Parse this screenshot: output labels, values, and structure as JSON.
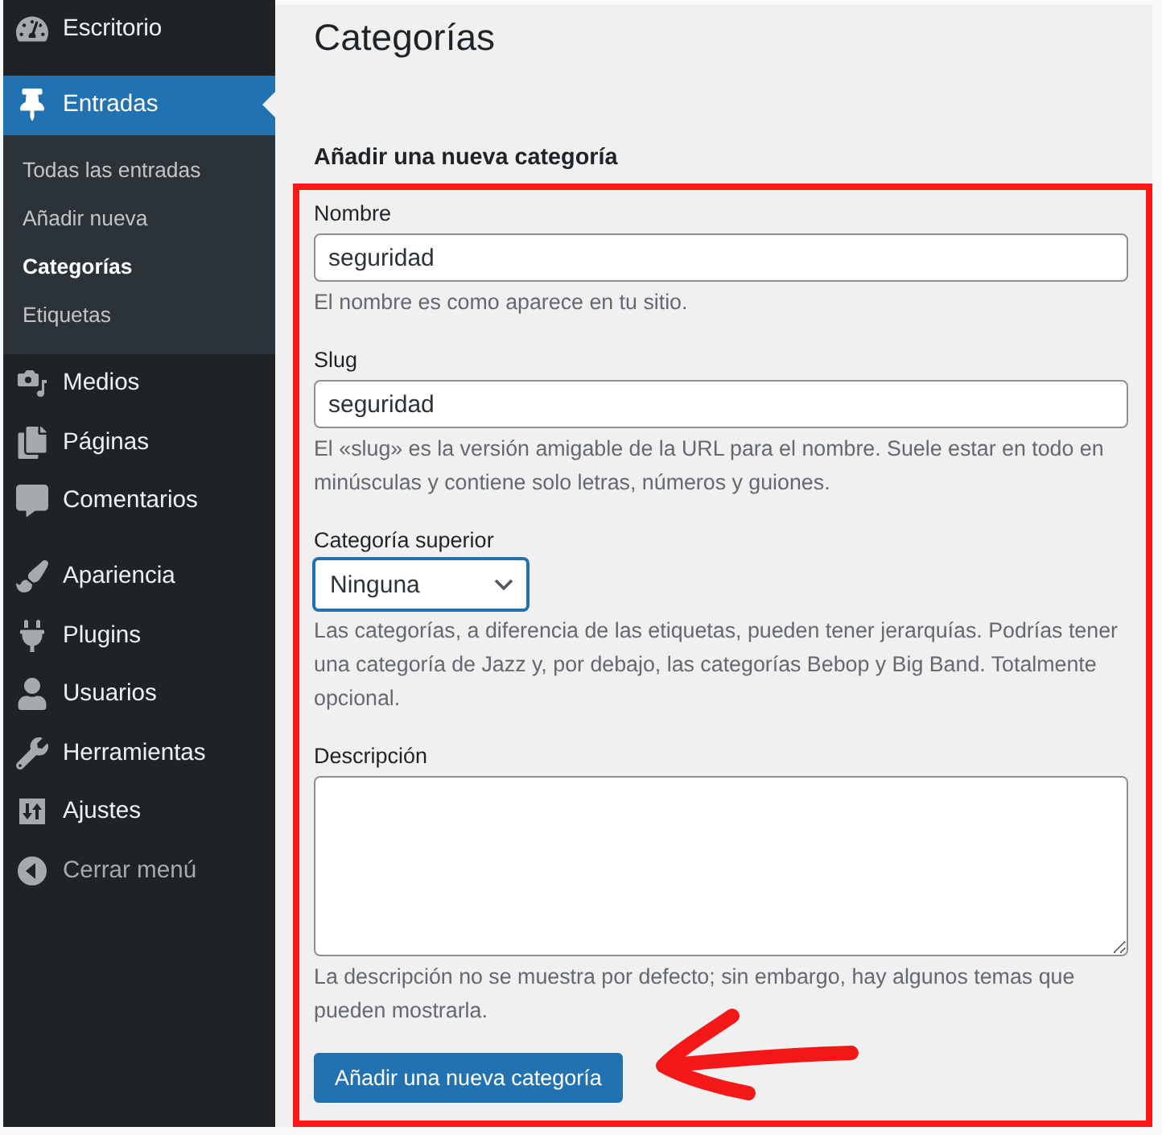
{
  "sidebar": {
    "groups": [
      {
        "items": [
          {
            "label": "Escritorio",
            "selected": false
          }
        ]
      },
      {
        "items": [
          {
            "label": "Entradas",
            "selected": true,
            "children": [
              {
                "label": "Todas las entradas",
                "selected": false
              },
              {
                "label": "Añadir nueva",
                "selected": false
              },
              {
                "label": "Categorías",
                "selected": true
              },
              {
                "label": "Etiquetas",
                "selected": false
              }
            ]
          },
          {
            "label": "Medios",
            "selected": false
          },
          {
            "label": "Páginas",
            "selected": false
          },
          {
            "label": "Comentarios",
            "selected": false
          }
        ]
      },
      {
        "items": [
          {
            "label": "Apariencia",
            "selected": false
          },
          {
            "label": "Plugins",
            "selected": false
          },
          {
            "label": "Usuarios",
            "selected": false
          },
          {
            "label": "Herramientas",
            "selected": false
          },
          {
            "label": "Ajustes",
            "selected": false
          }
        ]
      }
    ],
    "collapse": {
      "label": "Cerrar menú"
    }
  },
  "page": {
    "title": "Categorías"
  },
  "form": {
    "heading": "Añadir una nueva categoría",
    "fields": [
      {
        "kind": "text",
        "label": "Nombre",
        "value": "seguridad",
        "help": "El nombre es como aparece en tu sitio."
      },
      {
        "kind": "text",
        "label": "Slug",
        "value": "seguridad",
        "help": "El «slug» es la versión amigable de la URL para el nombre. Suele estar en todo en minúsculas y contiene solo letras, números y guiones."
      },
      {
        "kind": "select",
        "label": "Categoría superior",
        "value": "Ninguna",
        "focused": true,
        "help": "Las categorías, a diferencia de las etiquetas, pueden tener jerarquías. Podrías tener una categoría de Jazz y, por debajo, las categorías Bebop y Big Band. Totalmente opcional."
      },
      {
        "kind": "textarea",
        "label": "Descripción",
        "help": "La descripción no se muestra por defecto; sin embargo, hay algunos temas que pueden mostrarla."
      }
    ],
    "submit": {
      "label": "Añadir una nueva categoría"
    }
  },
  "annotations": {
    "frame": true,
    "arrow": true
  }
}
